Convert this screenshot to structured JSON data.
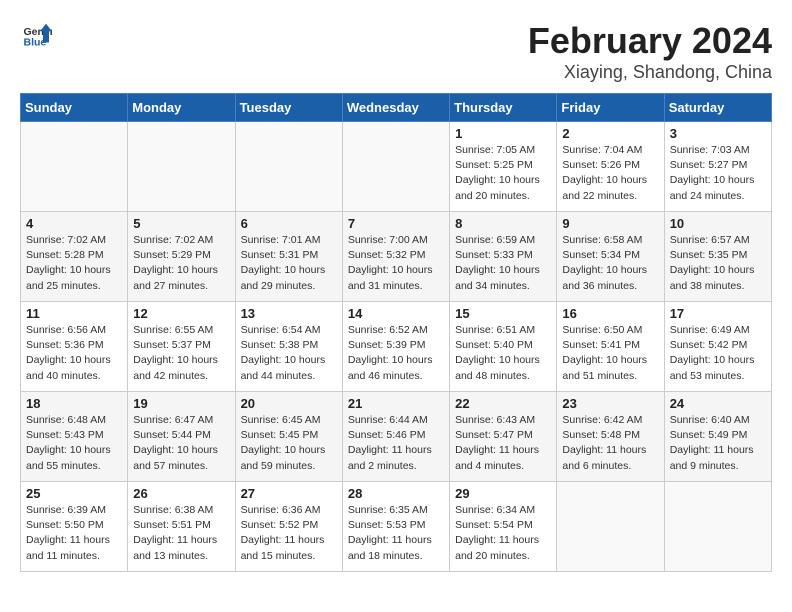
{
  "header": {
    "logo_general": "General",
    "logo_blue": "Blue",
    "month_year": "February 2024",
    "location": "Xiaying, Shandong, China"
  },
  "weekdays": [
    "Sunday",
    "Monday",
    "Tuesday",
    "Wednesday",
    "Thursday",
    "Friday",
    "Saturday"
  ],
  "weeks": [
    [
      {
        "day": "",
        "info": ""
      },
      {
        "day": "",
        "info": ""
      },
      {
        "day": "",
        "info": ""
      },
      {
        "day": "",
        "info": ""
      },
      {
        "day": "1",
        "info": "Sunrise: 7:05 AM\nSunset: 5:25 PM\nDaylight: 10 hours\nand 20 minutes."
      },
      {
        "day": "2",
        "info": "Sunrise: 7:04 AM\nSunset: 5:26 PM\nDaylight: 10 hours\nand 22 minutes."
      },
      {
        "day": "3",
        "info": "Sunrise: 7:03 AM\nSunset: 5:27 PM\nDaylight: 10 hours\nand 24 minutes."
      }
    ],
    [
      {
        "day": "4",
        "info": "Sunrise: 7:02 AM\nSunset: 5:28 PM\nDaylight: 10 hours\nand 25 minutes."
      },
      {
        "day": "5",
        "info": "Sunrise: 7:02 AM\nSunset: 5:29 PM\nDaylight: 10 hours\nand 27 minutes."
      },
      {
        "day": "6",
        "info": "Sunrise: 7:01 AM\nSunset: 5:31 PM\nDaylight: 10 hours\nand 29 minutes."
      },
      {
        "day": "7",
        "info": "Sunrise: 7:00 AM\nSunset: 5:32 PM\nDaylight: 10 hours\nand 31 minutes."
      },
      {
        "day": "8",
        "info": "Sunrise: 6:59 AM\nSunset: 5:33 PM\nDaylight: 10 hours\nand 34 minutes."
      },
      {
        "day": "9",
        "info": "Sunrise: 6:58 AM\nSunset: 5:34 PM\nDaylight: 10 hours\nand 36 minutes."
      },
      {
        "day": "10",
        "info": "Sunrise: 6:57 AM\nSunset: 5:35 PM\nDaylight: 10 hours\nand 38 minutes."
      }
    ],
    [
      {
        "day": "11",
        "info": "Sunrise: 6:56 AM\nSunset: 5:36 PM\nDaylight: 10 hours\nand 40 minutes."
      },
      {
        "day": "12",
        "info": "Sunrise: 6:55 AM\nSunset: 5:37 PM\nDaylight: 10 hours\nand 42 minutes."
      },
      {
        "day": "13",
        "info": "Sunrise: 6:54 AM\nSunset: 5:38 PM\nDaylight: 10 hours\nand 44 minutes."
      },
      {
        "day": "14",
        "info": "Sunrise: 6:52 AM\nSunset: 5:39 PM\nDaylight: 10 hours\nand 46 minutes."
      },
      {
        "day": "15",
        "info": "Sunrise: 6:51 AM\nSunset: 5:40 PM\nDaylight: 10 hours\nand 48 minutes."
      },
      {
        "day": "16",
        "info": "Sunrise: 6:50 AM\nSunset: 5:41 PM\nDaylight: 10 hours\nand 51 minutes."
      },
      {
        "day": "17",
        "info": "Sunrise: 6:49 AM\nSunset: 5:42 PM\nDaylight: 10 hours\nand 53 minutes."
      }
    ],
    [
      {
        "day": "18",
        "info": "Sunrise: 6:48 AM\nSunset: 5:43 PM\nDaylight: 10 hours\nand 55 minutes."
      },
      {
        "day": "19",
        "info": "Sunrise: 6:47 AM\nSunset: 5:44 PM\nDaylight: 10 hours\nand 57 minutes."
      },
      {
        "day": "20",
        "info": "Sunrise: 6:45 AM\nSunset: 5:45 PM\nDaylight: 10 hours\nand 59 minutes."
      },
      {
        "day": "21",
        "info": "Sunrise: 6:44 AM\nSunset: 5:46 PM\nDaylight: 11 hours\nand 2 minutes."
      },
      {
        "day": "22",
        "info": "Sunrise: 6:43 AM\nSunset: 5:47 PM\nDaylight: 11 hours\nand 4 minutes."
      },
      {
        "day": "23",
        "info": "Sunrise: 6:42 AM\nSunset: 5:48 PM\nDaylight: 11 hours\nand 6 minutes."
      },
      {
        "day": "24",
        "info": "Sunrise: 6:40 AM\nSunset: 5:49 PM\nDaylight: 11 hours\nand 9 minutes."
      }
    ],
    [
      {
        "day": "25",
        "info": "Sunrise: 6:39 AM\nSunset: 5:50 PM\nDaylight: 11 hours\nand 11 minutes."
      },
      {
        "day": "26",
        "info": "Sunrise: 6:38 AM\nSunset: 5:51 PM\nDaylight: 11 hours\nand 13 minutes."
      },
      {
        "day": "27",
        "info": "Sunrise: 6:36 AM\nSunset: 5:52 PM\nDaylight: 11 hours\nand 15 minutes."
      },
      {
        "day": "28",
        "info": "Sunrise: 6:35 AM\nSunset: 5:53 PM\nDaylight: 11 hours\nand 18 minutes."
      },
      {
        "day": "29",
        "info": "Sunrise: 6:34 AM\nSunset: 5:54 PM\nDaylight: 11 hours\nand 20 minutes."
      },
      {
        "day": "",
        "info": ""
      },
      {
        "day": "",
        "info": ""
      }
    ]
  ]
}
